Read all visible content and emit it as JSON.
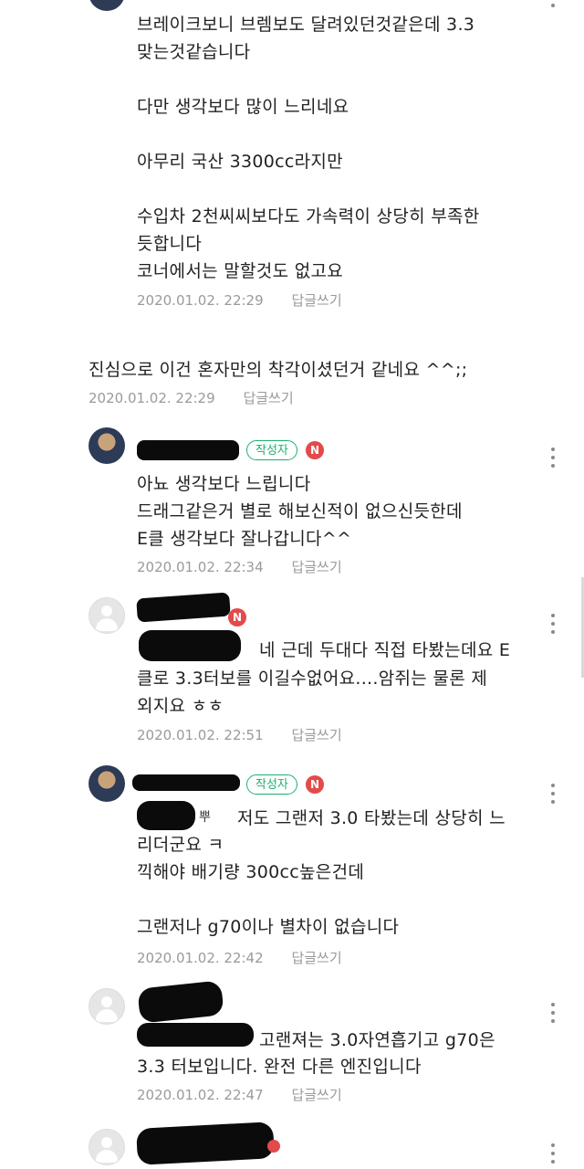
{
  "comments": [
    {
      "text": "브레이크보니 브렘보도 달려있던것같은데 3.3\n맞는것같습니다\n\n다만 생각보다 많이 느리네요\n\n아무리 국산 3300cc라지만\n\n수입차 2천씨씨보다도 가속력이 상당히 부족한\n듯합니다\n코너에서는 말할것도 없고요",
      "date": "2020.01.02. 22:29",
      "reply": "답글쓰기"
    },
    {
      "text": "진심으로 이건 혼자만의 착각이셨던거 같네요 ^^;;",
      "date": "2020.01.02. 22:29",
      "reply": "답글쓰기"
    },
    {
      "badge": "작성자",
      "n_badge": "N",
      "text": "아뇨 생각보다 느립니다\n드래그같은거 별로 해보신적이 없으신듯한데\nE클 생각보다 잘나갑니다^^",
      "date": "2020.01.02. 22:34",
      "reply": "답글쓰기"
    },
    {
      "n_badge": "N",
      "text_line1": "네 근데 두대다 직접 타봤는데요 E",
      "text_rest": "클로 3.3터보를 이길수없어요....암쥐는 물론 제\n외지요 ㅎㅎ",
      "date": "2020.01.02. 22:51",
      "reply": "답글쓰기"
    },
    {
      "badge": "작성자",
      "n_badge": "N",
      "mention_tail": "뿌",
      "text_line1": "저도 그랜저 3.0 타봤는데 상당히 느",
      "text_rest": "리더군요 ㅋ\n끽해야 배기량 300cc높은건데\n\n그랜저나 g70이나 별차이 없습니다",
      "date": "2020.01.02. 22:42",
      "reply": "답글쓰기"
    },
    {
      "text_line1": "고랜져는 3.0자연흡기고 g70은",
      "text_rest": "3.3 터보입니다. 완전 다른 엔진입니다",
      "date": "2020.01.02. 22:47",
      "reply": "답글쓰기"
    },
    {}
  ]
}
